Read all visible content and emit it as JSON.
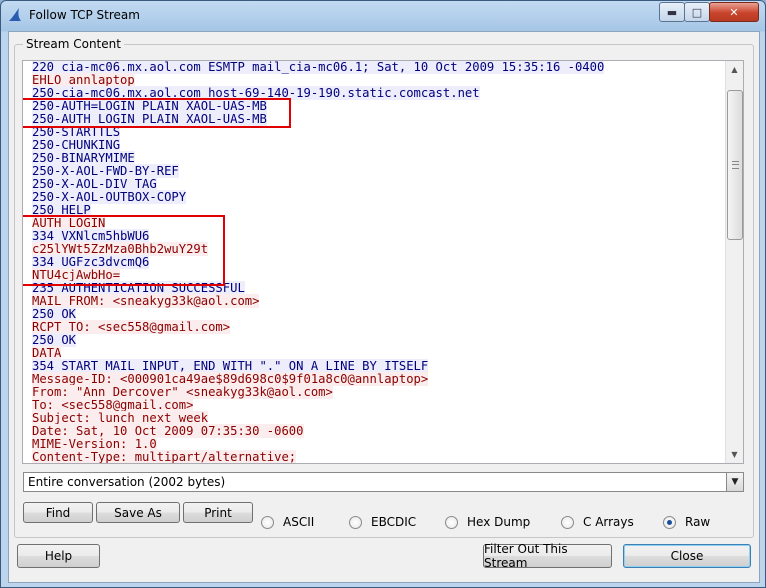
{
  "window": {
    "title": "Follow TCP Stream"
  },
  "stream": {
    "group_label": "Stream Content",
    "lines": [
      {
        "text": "220 cia-mc06.mx.aol.com ESMTP mail_cia-mc06.1; Sat, 10 Oct 2009 15:35:16 -0400",
        "dir": "server"
      },
      {
        "text": "EHLO annlaptop",
        "dir": "client"
      },
      {
        "text": "250-cia-mc06.mx.aol.com host-69-140-19-190.static.comcast.net",
        "dir": "server"
      },
      {
        "text": "250-AUTH=LOGIN PLAIN XAOL-UAS-MB",
        "dir": "server"
      },
      {
        "text": "250-AUTH LOGIN PLAIN XAOL-UAS-MB",
        "dir": "server"
      },
      {
        "text": "250-STARTTLS",
        "dir": "server"
      },
      {
        "text": "250-CHUNKING",
        "dir": "server"
      },
      {
        "text": "250-BINARYMIME",
        "dir": "server"
      },
      {
        "text": "250-X-AOL-FWD-BY-REF",
        "dir": "server"
      },
      {
        "text": "250-X-AOL-DIV_TAG",
        "dir": "server"
      },
      {
        "text": "250-X-AOL-OUTBOX-COPY",
        "dir": "server"
      },
      {
        "text": "250 HELP",
        "dir": "server"
      },
      {
        "text": "AUTH LOGIN",
        "dir": "client"
      },
      {
        "text": "334 VXNlcm5hbWU6",
        "dir": "server"
      },
      {
        "text": "c25lYWt5ZzMza0Bhb2wuY29t",
        "dir": "client"
      },
      {
        "text": "334 UGFzc3dvcmQ6",
        "dir": "server"
      },
      {
        "text": "NTU4cjAwbHo=",
        "dir": "client"
      },
      {
        "text": "235 AUTHENTICATION SUCCESSFUL",
        "dir": "server"
      },
      {
        "text": "MAIL FROM: <sneakyg33k@aol.com>",
        "dir": "client"
      },
      {
        "text": "250 OK",
        "dir": "server"
      },
      {
        "text": "RCPT TO: <sec558@gmail.com>",
        "dir": "client"
      },
      {
        "text": "250 OK",
        "dir": "server"
      },
      {
        "text": "DATA",
        "dir": "client"
      },
      {
        "text": "354 START MAIL INPUT, END WITH \".\" ON A LINE BY ITSELF",
        "dir": "server"
      },
      {
        "text": "Message-ID: <000901ca49ae$89d698c0$9f01a8c0@annlaptop>",
        "dir": "client"
      },
      {
        "text": "From: \"Ann Dercover\" <sneakyg33k@aol.com>",
        "dir": "client"
      },
      {
        "text": "To: <sec558@gmail.com>",
        "dir": "client"
      },
      {
        "text": "Subject: lunch next week",
        "dir": "client"
      },
      {
        "text": "Date: Sat, 10 Oct 2009 07:35:30 -0600",
        "dir": "client"
      },
      {
        "text": "MIME-Version: 1.0",
        "dir": "client"
      },
      {
        "text": "Content-Type: multipart/alternative;",
        "dir": "client"
      }
    ],
    "client_color": "#8b0000",
    "server_color": "#00007c",
    "highlight_color": "#e00000"
  },
  "conversation_select": {
    "value": "Entire conversation (2002 bytes)"
  },
  "actions": {
    "find": "Find",
    "save_as": "Save As",
    "print": "Print"
  },
  "formats": {
    "options": [
      "ASCII",
      "EBCDIC",
      "Hex Dump",
      "C Arrays",
      "Raw"
    ],
    "selected": "Raw"
  },
  "footer": {
    "help": "Help",
    "filter_out": "Filter Out This Stream",
    "close": "Close"
  }
}
